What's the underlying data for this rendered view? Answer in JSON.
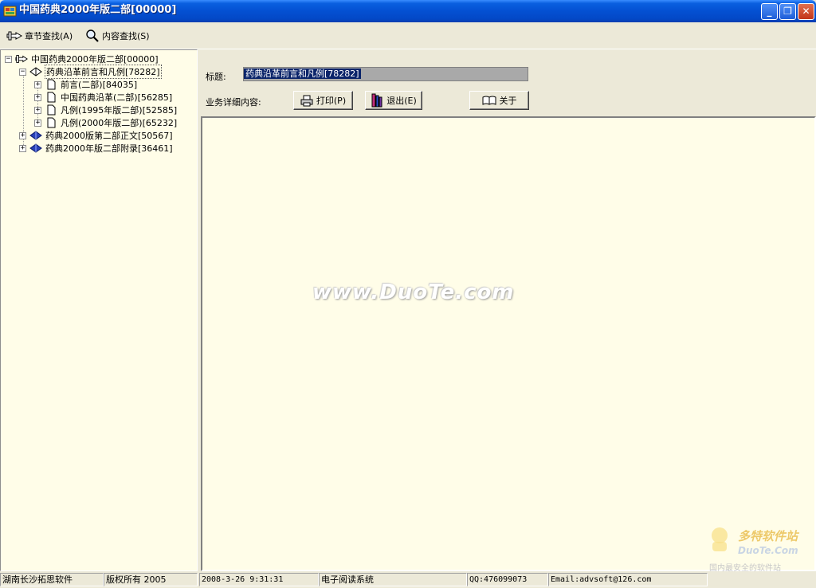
{
  "window": {
    "title": "中国药典2000年版二部[00000]",
    "minimize_glyph": "_",
    "restore_glyph": "❐",
    "close_glyph": "✕"
  },
  "toolbar": {
    "chapter_search_label": "章节查找(A)",
    "content_search_label": "内容查找(S)",
    "chapter_search_icon": "hand-pointer-icon",
    "content_search_icon": "magnifier-icon"
  },
  "tree": {
    "root": {
      "label": "中国药典2000年版二部[00000]",
      "expander": "−"
    },
    "children": [
      {
        "label": "药典沿革前言和凡例[78282]",
        "expander": "−",
        "icon": "open-book-icon"
      },
      {
        "label": "前言(二部)[84035]",
        "expander": "+",
        "icon": "page-icon"
      },
      {
        "label": "中国药典沿革(二部)[56285]",
        "expander": "+",
        "icon": "page-icon"
      },
      {
        "label": "凡例(1995年版二部)[52585]",
        "expander": "+",
        "icon": "page-icon"
      },
      {
        "label": "凡例(2000年版二部)[65232]",
        "expander": "+",
        "icon": "page-icon"
      },
      {
        "label": "药典2000版第二部正文[50567]",
        "expander": "+",
        "icon": "closed-book-icon"
      },
      {
        "label": "药典2000年版二部附录[36461]",
        "expander": "+",
        "icon": "closed-book-icon"
      }
    ]
  },
  "detail": {
    "title_label": "标题:",
    "title_value": "药典沿革前言和凡例[78282]",
    "content_label": "业务详细内容:",
    "print_label": "打印(P)",
    "exit_label": "退出(E)",
    "about_label": "关于"
  },
  "watermark": {
    "text": "www.DuoTe.com",
    "logo_text": "多特软件站",
    "logo_sub": "DuoTe.Com",
    "logo_slogan": "国内最安全的软件站"
  },
  "status": {
    "company": "湖南长沙拓思软件",
    "copyright": "版权所有 2005",
    "datetime": "2008-3-26 9:31:31",
    "system": "电子阅读系统",
    "qq": "QQ:476099073",
    "email": "Email:advsoft@126.com"
  },
  "colors": {
    "title_bar": "#0450D2",
    "pane_background": "#FFFDE8",
    "window_face": "#ECE9D8",
    "selection": "#0A246A"
  }
}
